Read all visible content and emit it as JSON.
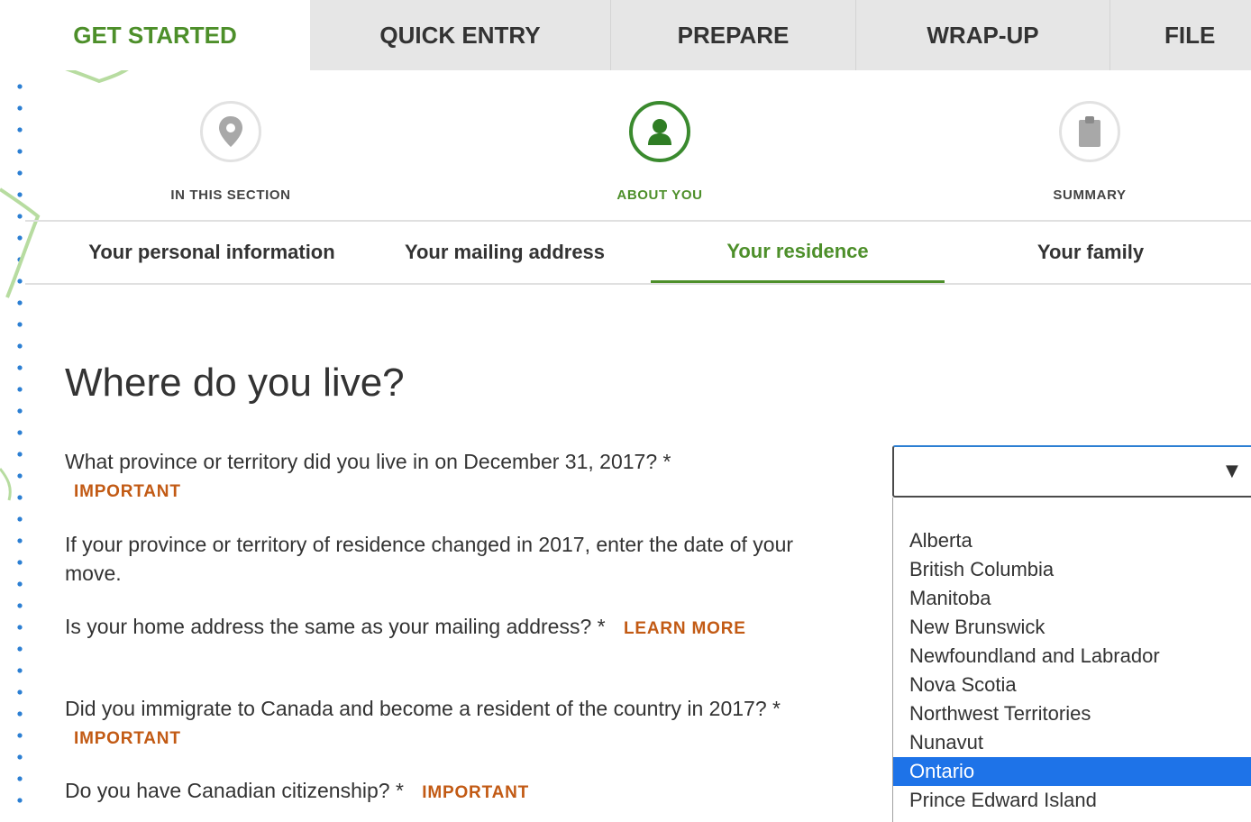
{
  "tabs": [
    {
      "label": "GET STARTED"
    },
    {
      "label": "QUICK ENTRY"
    },
    {
      "label": "PREPARE"
    },
    {
      "label": "WRAP-UP"
    },
    {
      "label": "FILE"
    }
  ],
  "steps": [
    {
      "label": "IN THIS SECTION",
      "icon": "map-pin-icon"
    },
    {
      "label": "ABOUT YOU",
      "icon": "person-icon"
    },
    {
      "label": "SUMMARY",
      "icon": "clipboard-icon"
    }
  ],
  "subnav": [
    {
      "label": "Your personal information"
    },
    {
      "label": "Your mailing address"
    },
    {
      "label": "Your residence"
    },
    {
      "label": "Your family"
    }
  ],
  "page": {
    "title": "Where do you live?"
  },
  "questions": [
    {
      "text": "What province or territory did you live in on December 31, 2017? *",
      "tag": "IMPORTANT"
    },
    {
      "text": "If your province or territory of residence changed in 2017, enter the date of your move."
    },
    {
      "text": "Is your home address the same as your mailing address? *",
      "tag": "LEARN MORE"
    },
    {
      "text": "Did you immigrate to Canada and become a resident of the country in 2017? *",
      "tag": "IMPORTANT"
    },
    {
      "text": "Do you have Canadian citizenship? *",
      "tag": "IMPORTANT"
    }
  ],
  "province_select": {
    "value": "",
    "arrow": "▼",
    "options": [
      "Alberta",
      "British Columbia",
      "Manitoba",
      "New Brunswick",
      "Newfoundland and Labrador",
      "Nova Scotia",
      "Northwest Territories",
      "Nunavut",
      "Ontario",
      "Prince Edward Island"
    ],
    "highlighted": "Ontario"
  },
  "colors": {
    "accent_green": "#4d8f2a",
    "tag_orange": "#c25a14",
    "highlight_blue": "#1e73e8",
    "dot_blue": "#2c7fd3"
  }
}
